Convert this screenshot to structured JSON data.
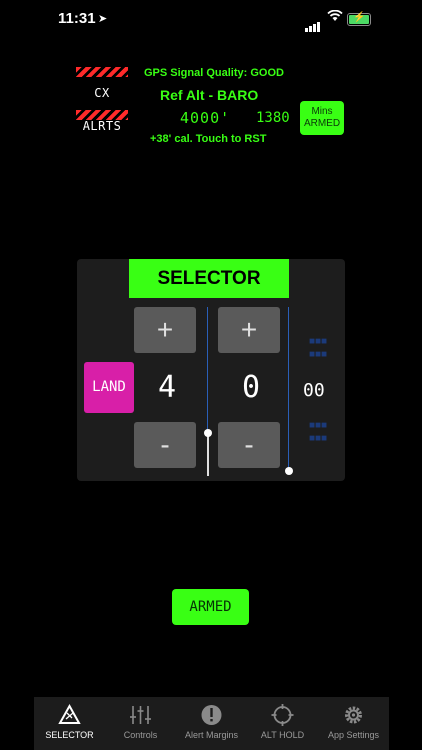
{
  "status": {
    "time": "11:31"
  },
  "logo": {
    "text": "CX ALRTS"
  },
  "header": {
    "gps_quality": "GPS Signal Quality: GOOD",
    "ref_alt": "Ref Alt - BARO",
    "alt_value": "4000'",
    "alt_value2": "1380",
    "calibration": "+38' cal. Touch to RST",
    "mins_line1": "Mins",
    "mins_line2": "ARMED"
  },
  "selector": {
    "title": "SELECTOR",
    "land_label": "LAND",
    "digit_left": "4",
    "digit_right": "0",
    "digit_small": "00",
    "plus_label": "+",
    "minus_label": "-"
  },
  "armed_label": "ARMED",
  "tabs": [
    {
      "label": "SELECTOR",
      "icon": "selector-icon",
      "active": true
    },
    {
      "label": "Controls",
      "icon": "sliders-icon",
      "active": false
    },
    {
      "label": "Alert Margins",
      "icon": "alert-icon",
      "active": false
    },
    {
      "label": "ALT HOLD",
      "icon": "crosshair-icon",
      "active": false
    },
    {
      "label": "App Settings",
      "icon": "gear-icon",
      "active": false
    }
  ],
  "colors": {
    "accent": "#39ff14",
    "land": "#d81fa8",
    "background": "#000000"
  }
}
